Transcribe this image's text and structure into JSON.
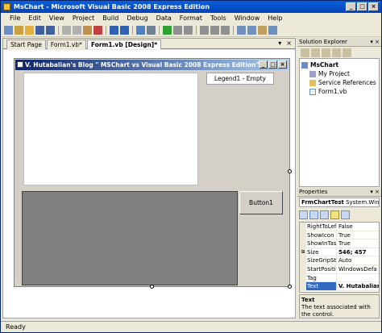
{
  "window": {
    "title": "MsChart - Microsoft Visual Basic 2008 Express Edition"
  },
  "menu": [
    "File",
    "Edit",
    "View",
    "Project",
    "Build",
    "Debug",
    "Data",
    "Format",
    "Tools",
    "Window",
    "Help"
  ],
  "tabs": [
    {
      "label": "Start Page"
    },
    {
      "label": "Form1.vb*"
    },
    {
      "label": "Form1.vb [Design]*",
      "active": true
    }
  ],
  "form": {
    "title": "V. Hutabalian's Blog \" MSChart vs Visual Basic 2008 Express Edition\"",
    "legend": "Legend1 - Empty",
    "button": "Button1"
  },
  "solution_explorer": {
    "title": "Solution Explorer",
    "items": [
      "MsChart",
      "My Project",
      "Service References",
      "Form1.vb"
    ]
  },
  "properties": {
    "title": "Properties",
    "object_name": "FrmChartTest",
    "object_type": "System.Windows",
    "rows": [
      {
        "name": "RightToLeftL",
        "value": "False"
      },
      {
        "name": "ShowIcon",
        "value": "True"
      },
      {
        "name": "ShowInTaskl",
        "value": "True"
      },
      {
        "name": "Size",
        "value": "546; 457",
        "expand": "⊞",
        "bold": true
      },
      {
        "name": "SizeGripStyle",
        "value": "Auto"
      },
      {
        "name": "StartPosition",
        "value": "WindowsDefa"
      },
      {
        "name": "Tag",
        "value": ""
      },
      {
        "name": "Text",
        "value": "V. Hutabalian",
        "bold": true,
        "selected": true
      }
    ],
    "desc_title": "Text",
    "desc_text": "The text associated with the control."
  },
  "status": {
    "text": "Ready"
  },
  "colors": {
    "title_bar": "#0a5fd8",
    "panel": "#808080",
    "selection": "#316ac5"
  }
}
